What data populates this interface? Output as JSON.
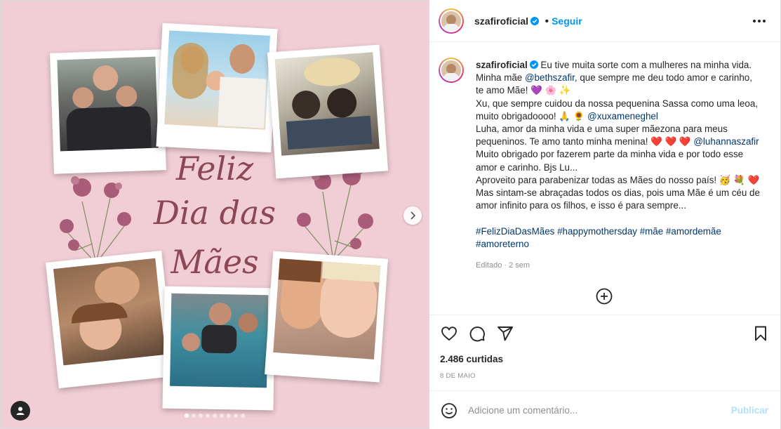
{
  "post": {
    "username": "szafiroficial",
    "follow_label": "Seguir",
    "caption_lines": [
      [
        {
          "t": "Eu tive muita sorte com a mulheres na minha vida."
        }
      ],
      [
        {
          "t": "Minha mãe "
        },
        {
          "t": "@bethszafir",
          "k": "mention"
        },
        {
          "t": ", que sempre me deu todo amor e carinho,"
        }
      ],
      [
        {
          "t": "te amo Mãe! 💜 🌸 ✨"
        }
      ],
      [
        {
          "t": "Xu, que sempre cuidou da nossa pequenina Sassa como uma leoa,"
        }
      ],
      [
        {
          "t": "muito obrigadoooo! 🙏 🌻 "
        },
        {
          "t": "@xuxameneghel",
          "k": "mention"
        }
      ],
      [
        {
          "t": "Luha, amor da minha vida e uma super mãezona para meus"
        }
      ],
      [
        {
          "t": "pequeninos. Te amo tanto minha menina! ❤️ ❤️ ❤️  "
        },
        {
          "t": "@luhannaszafir",
          "k": "mention"
        }
      ],
      [
        {
          "t": "Muito obrigado por fazerem parte da minha vida e por todo esse"
        }
      ],
      [
        {
          "t": "amor e carinho. Bjs Lu..."
        }
      ],
      [
        {
          "t": "Aproveito para parabenizar todas as Mães do nosso país! 🥳 💐 ❤️"
        }
      ],
      [
        {
          "t": "Mas sintam-se abraçadas todos os dias, pois uma Mãe é um céu de"
        }
      ],
      [
        {
          "t": "amor infinito para os filhos, e isso é para sempre..."
        }
      ],
      [
        {
          "t": ""
        }
      ],
      [
        {
          "t": "#FelizDiaDasMães #happymothersday #mãe #amordemãe",
          "k": "tag"
        }
      ],
      [
        {
          "t": "#amoreterno",
          "k": "tag"
        }
      ]
    ],
    "edited_label": "Editado · 2 sem",
    "likes_label": "2.486 curtidas",
    "date_label": "8 DE MAIO",
    "comment_placeholder": "Adicione um comentário...",
    "publish_label": "Publicar"
  },
  "image_text": {
    "line1": "Feliz",
    "line2": "Dia das",
    "line3": "Mães"
  },
  "carousel": {
    "total_slides": 9,
    "active_index": 0
  },
  "colors": {
    "background_pink": "#f1cdd5",
    "script_text": "#8c4756",
    "link_blue": "#0095f6",
    "mention_blue": "#00376b",
    "verified_blue": "#0095f6"
  },
  "icons": [
    "more-options-icon",
    "heart-icon",
    "comment-icon",
    "share-icon",
    "bookmark-icon",
    "add-circle-icon",
    "emoji-icon",
    "next-arrow-icon",
    "user-tag-icon",
    "verified-badge-icon"
  ]
}
